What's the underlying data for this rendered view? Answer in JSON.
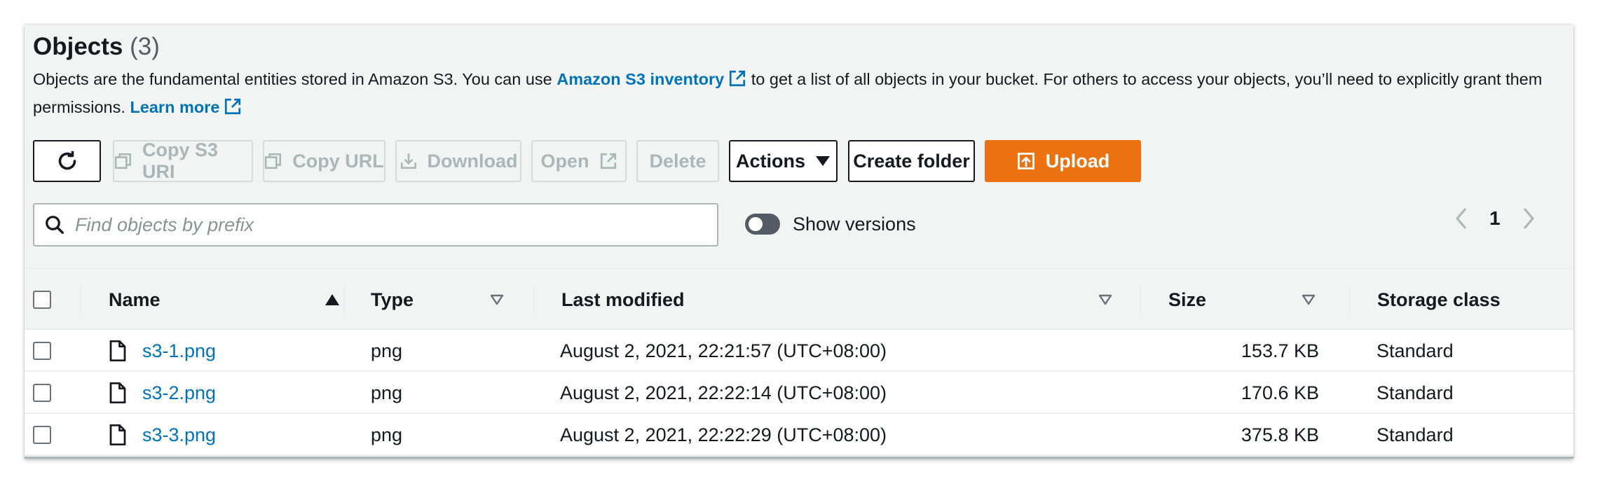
{
  "header": {
    "title": "Objects",
    "count": "(3)",
    "desc_part1": "Objects are the fundamental entities stored in Amazon S3. You can use ",
    "inventory_link": "Amazon S3 inventory",
    "desc_part2": " to get a list of all objects in your bucket. For others to access your objects, you’ll need to explicitly grant them permissions. ",
    "learn_more": "Learn more"
  },
  "toolbar": {
    "copy_s3_uri": "Copy S3 URI",
    "copy_url": "Copy URL",
    "download": "Download",
    "open": "Open",
    "delete": "Delete",
    "actions": "Actions",
    "create_folder": "Create folder",
    "upload": "Upload"
  },
  "search": {
    "placeholder": "Find objects by prefix"
  },
  "versions": {
    "label": "Show versions"
  },
  "pager": {
    "page": "1"
  },
  "table": {
    "columns": {
      "name": "Name",
      "type": "Type",
      "last_modified": "Last modified",
      "size": "Size",
      "storage_class": "Storage class"
    },
    "rows": [
      {
        "name": "s3-1.png",
        "type": "png",
        "last_modified": "August 2, 2021, 22:21:57 (UTC+08:00)",
        "size": "153.7 KB",
        "storage_class": "Standard"
      },
      {
        "name": "s3-2.png",
        "type": "png",
        "last_modified": "August 2, 2021, 22:22:14 (UTC+08:00)",
        "size": "170.6 KB",
        "storage_class": "Standard"
      },
      {
        "name": "s3-3.png",
        "type": "png",
        "last_modified": "August 2, 2021, 22:22:29 (UTC+08:00)",
        "size": "375.8 KB",
        "storage_class": "Standard"
      }
    ]
  },
  "colors": {
    "link": "#0073bb",
    "primary": "#ec7211",
    "disabled": "#aab7b8"
  }
}
